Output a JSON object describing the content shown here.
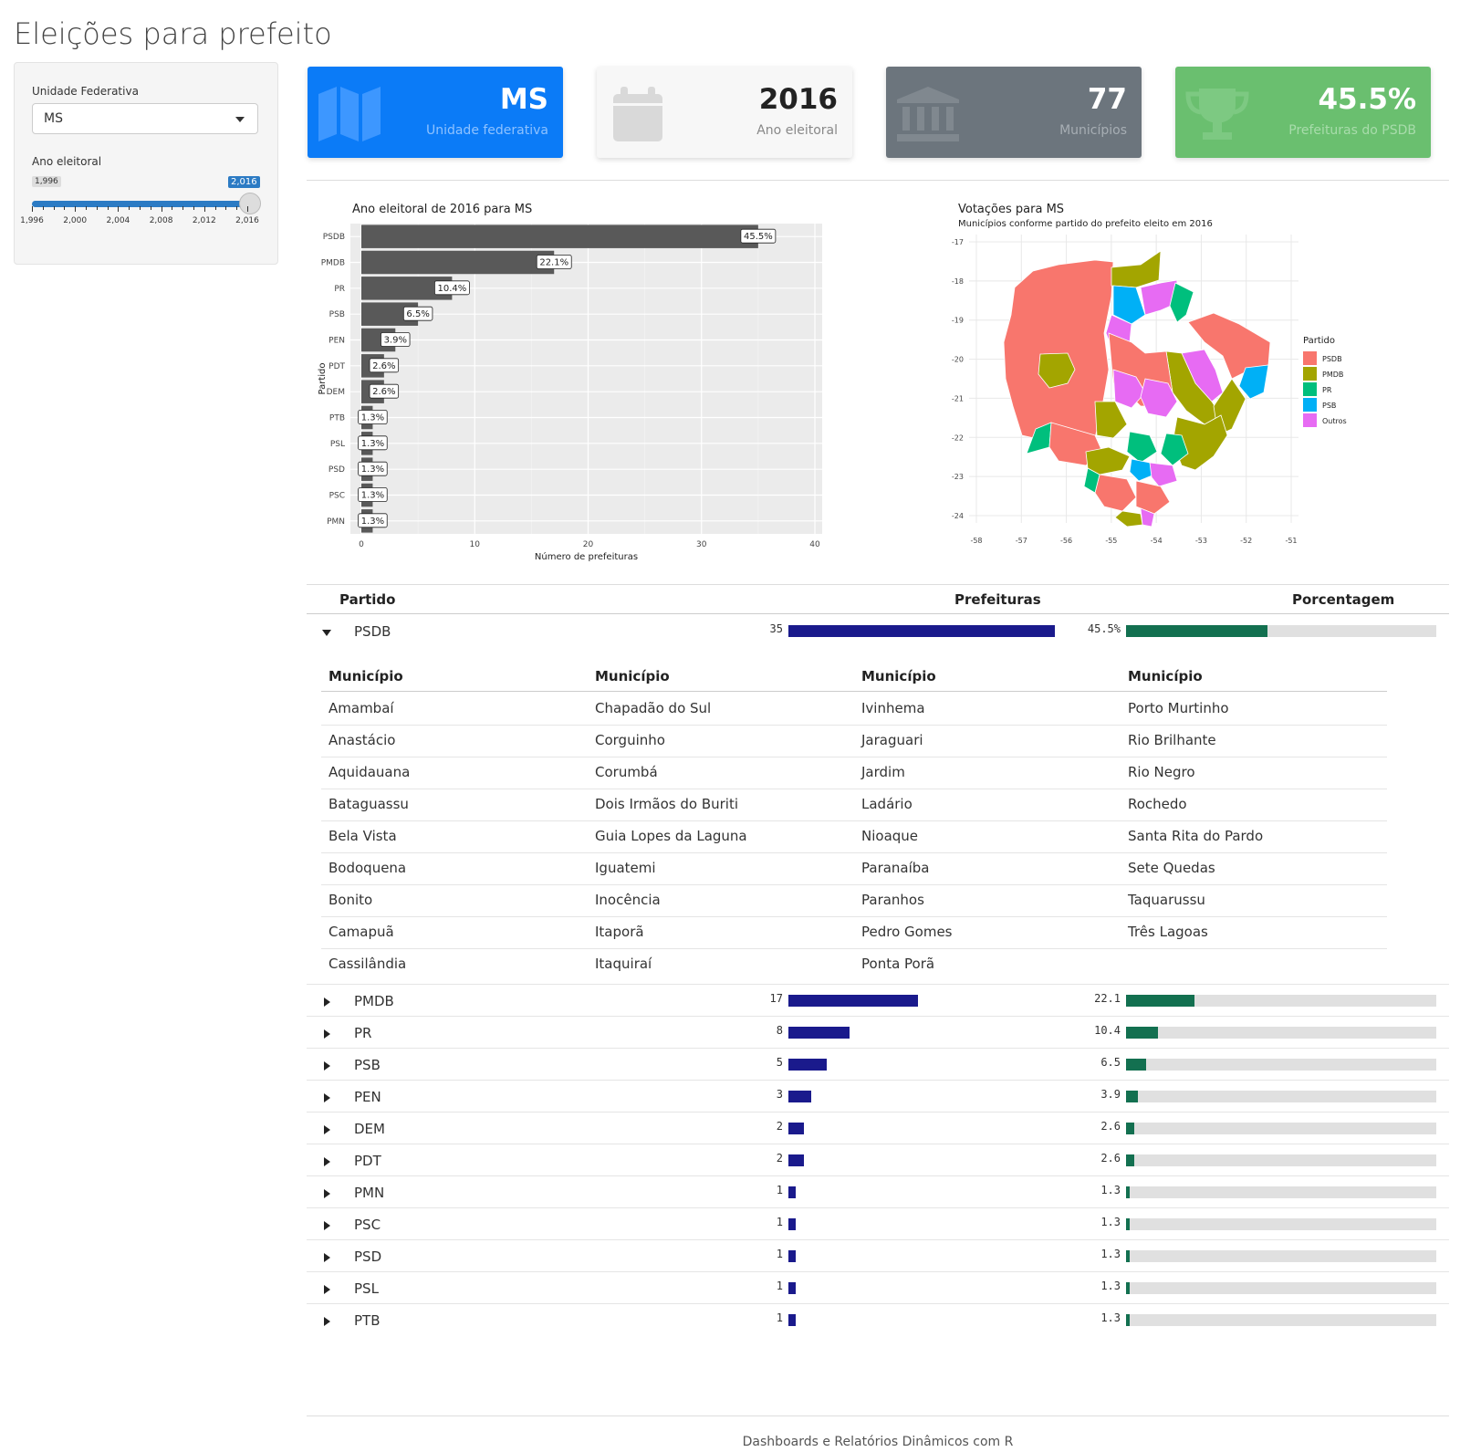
{
  "app": {
    "title": "Eleições para prefeito",
    "footer": "Dashboards e Relatórios Dinâmicos com R"
  },
  "sidebar": {
    "uf_label": "Unidade Federativa",
    "uf_value": "MS",
    "year_label": "Ano eleitoral",
    "year_min": "1,996",
    "year_max": "2,016",
    "year_selected_fraction": 1.0,
    "ticks": [
      "1,996",
      "2,000",
      "2,004",
      "2,008",
      "2,012",
      "2,016"
    ]
  },
  "value_boxes": [
    {
      "value": "MS",
      "caption": "Unidade federativa",
      "icon": "map-icon",
      "bg": "#0b7bf7",
      "fg": "#ffffff",
      "cap": "#8ec2ff",
      "iconcolor": "#3d97ff"
    },
    {
      "value": "2016",
      "caption": "Ano eleitoral",
      "icon": "calendar-icon",
      "bg": "#f7f7f7",
      "fg": "#222222",
      "cap": "#888888",
      "iconcolor": "#d9d9d9"
    },
    {
      "value": "77",
      "caption": "Municípios",
      "icon": "bank-icon",
      "bg": "#6c757d",
      "fg": "#ffffff",
      "cap": "#a7aeb4",
      "iconcolor": "#80888f"
    },
    {
      "value": "45.5%",
      "caption": "Prefeituras do PSDB",
      "icon": "trophy-icon",
      "bg": "#6abf6f",
      "fg": "#ffffff",
      "cap": "#a8dcab",
      "iconcolor": "#7dc982"
    }
  ],
  "chart_data": [
    {
      "type": "bar",
      "title": "Ano eleitoral de 2016 para MS",
      "xlabel": "Número de prefeituras",
      "ylabel": "Partido",
      "categories": [
        "PSDB",
        "PMDB",
        "PR",
        "PSB",
        "PEN",
        "PDT",
        "DEM",
        "PTB",
        "PSL",
        "PSD",
        "PSC",
        "PMN"
      ],
      "values": [
        35,
        17,
        8,
        5,
        3,
        2,
        2,
        1,
        1,
        1,
        1,
        1
      ],
      "labels": [
        "45.5%",
        "22.1%",
        "10.4%",
        "6.5%",
        "3.9%",
        "2.6%",
        "2.6%",
        "1.3%",
        "1.3%",
        "1.3%",
        "1.3%",
        "1.3%"
      ],
      "xticks": [
        "0",
        "10",
        "20",
        "30",
        "40"
      ],
      "xlim": [
        0,
        40
      ],
      "orientation": "horizontal",
      "grid": true
    },
    {
      "type": "map",
      "title": "Votações para MS",
      "subtitle": "Municípios conforme partido do prefeito eleito em 2016",
      "legend_title": "Partido",
      "legend": [
        {
          "name": "PSDB",
          "color": "#f8766d"
        },
        {
          "name": "PMDB",
          "color": "#a3a500"
        },
        {
          "name": "PR",
          "color": "#00bf7d"
        },
        {
          "name": "PSB",
          "color": "#00b0f6"
        },
        {
          "name": "Outros",
          "color": "#e76bf3"
        }
      ],
      "legend_position": "right",
      "xticks": [
        "-58",
        "-57",
        "-56",
        "-55",
        "-54",
        "-53",
        "-52",
        "-51"
      ],
      "yticks": [
        "-17",
        "-18",
        "-19",
        "-20",
        "-21",
        "-22",
        "-23",
        "-24"
      ],
      "xlim": [
        -58,
        -51
      ],
      "ylim": [
        -24,
        -17
      ]
    }
  ],
  "table": {
    "headers": {
      "partido": "Partido",
      "prefeituras": "Prefeituras",
      "porcentagem": "Porcentagem"
    },
    "max_count": 35,
    "expanded": {
      "party": "PSDB",
      "count": "35",
      "pct": "45.5%",
      "count_val": 35,
      "pct_val": 45.5,
      "subheader": "Município",
      "municipios": [
        [
          "Amambaí",
          "Anastácio",
          "Aquidauana",
          "Bataguassu",
          "Bela Vista",
          "Bodoquena",
          "Bonito",
          "Camapuã",
          "Cassilândia"
        ],
        [
          "Chapadão do Sul",
          "Corguinho",
          "Corumbá",
          "Dois Irmãos do Buriti",
          "Guia Lopes da Laguna",
          "Iguatemi",
          "Inocência",
          "Itaporã",
          "Itaquiraí"
        ],
        [
          "Ivinhema",
          "Jaraguari",
          "Jardim",
          "Ladário",
          "Nioaque",
          "Paranaíba",
          "Paranhos",
          "Pedro Gomes",
          "Ponta Porã"
        ],
        [
          "Porto Murtinho",
          "Rio Brilhante",
          "Rio Negro",
          "Rochedo",
          "Santa Rita do Pardo",
          "Sete Quedas",
          "Taquarussu",
          "Três Lagoas"
        ]
      ]
    },
    "rows": [
      {
        "party": "PMDB",
        "count": "17",
        "pct": "22.1",
        "count_val": 17,
        "pct_val": 22.1
      },
      {
        "party": "PR",
        "count": "8",
        "pct": "10.4",
        "count_val": 8,
        "pct_val": 10.4
      },
      {
        "party": "PSB",
        "count": "5",
        "pct": "6.5",
        "count_val": 5,
        "pct_val": 6.5
      },
      {
        "party": "PEN",
        "count": "3",
        "pct": "3.9",
        "count_val": 3,
        "pct_val": 3.9
      },
      {
        "party": "DEM",
        "count": "2",
        "pct": "2.6",
        "count_val": 2,
        "pct_val": 2.6
      },
      {
        "party": "PDT",
        "count": "2",
        "pct": "2.6",
        "count_val": 2,
        "pct_val": 2.6
      },
      {
        "party": "PMN",
        "count": "1",
        "pct": "1.3",
        "count_val": 1,
        "pct_val": 1.3
      },
      {
        "party": "PSC",
        "count": "1",
        "pct": "1.3",
        "count_val": 1,
        "pct_val": 1.3
      },
      {
        "party": "PSD",
        "count": "1",
        "pct": "1.3",
        "count_val": 1,
        "pct_val": 1.3
      },
      {
        "party": "PSL",
        "count": "1",
        "pct": "1.3",
        "count_val": 1,
        "pct_val": 1.3
      },
      {
        "party": "PTB",
        "count": "1",
        "pct": "1.3",
        "count_val": 1,
        "pct_val": 1.3
      }
    ]
  }
}
